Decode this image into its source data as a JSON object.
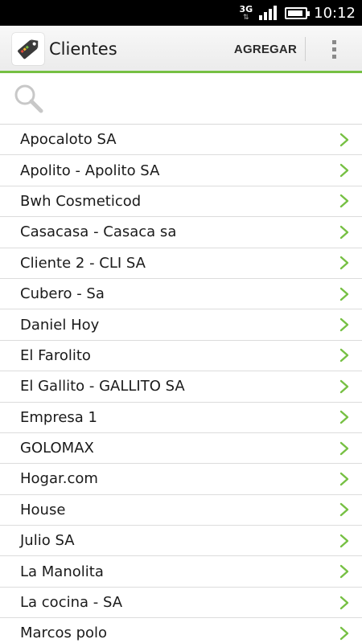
{
  "status_bar": {
    "network_type": "3G",
    "time": "10:12",
    "battery_level": 0.9,
    "signal_bars": 4
  },
  "action_bar": {
    "title": "Clientes",
    "add_label": "AGREGAR",
    "accent_color": "#76c043"
  },
  "search": {
    "placeholder": "",
    "value": ""
  },
  "clients": [
    "Apocaloto SA",
    "Apolito - Apolito SA",
    "Bwh Cosmeticod",
    "Casacasa - Casaca sa",
    "Cliente 2 - CLI SA",
    "Cubero - Sa",
    "Daniel Hoy",
    "El Farolito",
    "El Gallito - GALLITO SA",
    "Empresa 1",
    "GOLOMAX",
    "Hogar.com",
    "House",
    "Julio SA",
    "La Manolita",
    "La cocina - SA",
    "Marcos polo"
  ]
}
